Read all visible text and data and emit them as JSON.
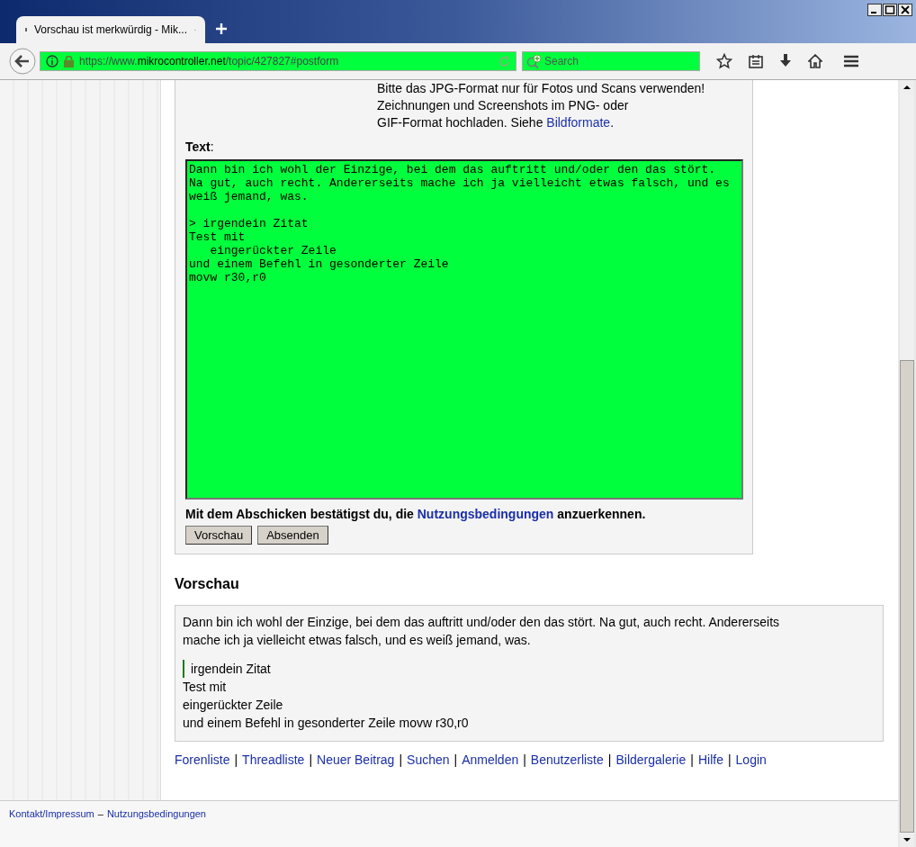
{
  "browser": {
    "tab": {
      "title": "Vorschau ist merkwürdig - Mik...",
      "selected": true
    },
    "url": "https://www.**mikrocontroller.net**/topic/427827#postform",
    "search": {
      "placeholder": "Search"
    }
  },
  "form": {
    "note_lines": [
      "Bitte das JPG-Format nur für Fotos und Scans verwenden!",
      "Zeichnungen und Screenshots im PNG- oder"
    ],
    "note_last": "GIF-Format hochladen. Siehe",
    "note_link": "Bildformate",
    "note_end": ".",
    "text_label": "Text",
    "text_label_colon": ":",
    "text_value": "Dann bin ich wohl der Einzige, bei dem das auftritt und/oder den das stört.\nNa gut, auch recht. Andererseits mache ich ja vielleicht etwas falsch, und es\nweiß jemand, was.\n\n> irgendein Zitat\nTest mit\n   eingerückter Zeile\nund einem Befehl in gesonderter Zeile\nmovw r30,r0",
    "consent_before": "Mit dem Abschicken bestätigst du, die",
    "consent_link": "Nutzungsbedingungen",
    "consent_after": "anzuerkennen.",
    "buttons": [
      "Vorschau",
      "Absenden"
    ]
  },
  "preview": {
    "heading": "Vorschau",
    "blocks": [
      {
        "kind": "paragraph",
        "text": "Dann bin ich wohl der Einzige, bei dem das auftritt und/oder den das stört. Na gut, auch recht. Andererseits mache ich ja vielleicht etwas falsch, und es weiß jemand, was."
      },
      {
        "kind": "quote",
        "text": "irgendein Zitat"
      },
      {
        "kind": "line",
        "text": "Test mit"
      },
      {
        "kind": "line",
        "text": "eingerückter Zeile"
      },
      {
        "kind": "line",
        "text": "und einem Befehl in gesonderter Zeile movw r30,r0"
      }
    ]
  },
  "nav_links": {
    "separator": "|",
    "items": [
      "Forenliste",
      "Threadliste",
      "Neuer Beitrag",
      "Suchen",
      "Anmelden",
      "Benutzerliste",
      "Bildergalerie",
      "Hilfe",
      "Login"
    ]
  },
  "footer": {
    "links": [
      "Kontakt/Impressum",
      "Nutzungsbedingungen"
    ],
    "separator": "–"
  }
}
